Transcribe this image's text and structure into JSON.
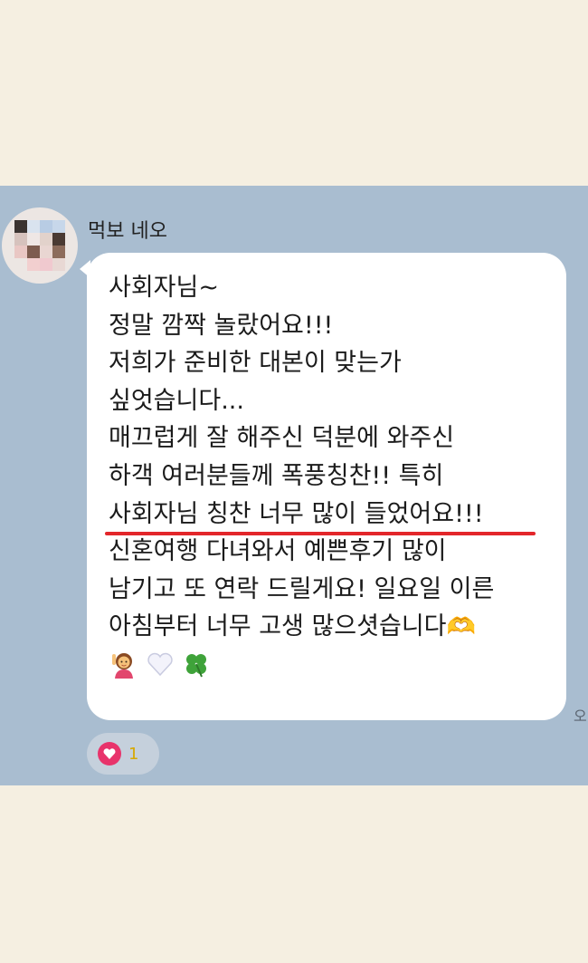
{
  "chat": {
    "sender_name": "먹보 네오",
    "message_lines": [
      "사회자님~",
      "정말 깜짝 놀랐어요!!!",
      "저희가 준비한 대본이 맞는가",
      "싶엇습니다...",
      "매끄럽게 잘 해주신 덕분에 와주신",
      "하객 여러분들께 폭풍칭찬!! 특히",
      "사회자님 칭찬 너무 많이 들었어요!!!",
      "신혼여행 다녀와서 예쁜후기 많이",
      "남기고 또 연락 드릴게요! 일요일 이른",
      "아침부터 너무 고생 많으셧습니다"
    ],
    "emojis": [
      "girl-raising-hand",
      "white-heart",
      "four-leaf-clover"
    ],
    "time_partial": "오",
    "reaction": {
      "icon": "heart-icon",
      "count": "1"
    },
    "colors": {
      "chat_background": "#a9bdd0",
      "page_background": "#f5efe1",
      "highlight_underline": "#e3262a",
      "reaction_heart": "#e8336b"
    }
  }
}
